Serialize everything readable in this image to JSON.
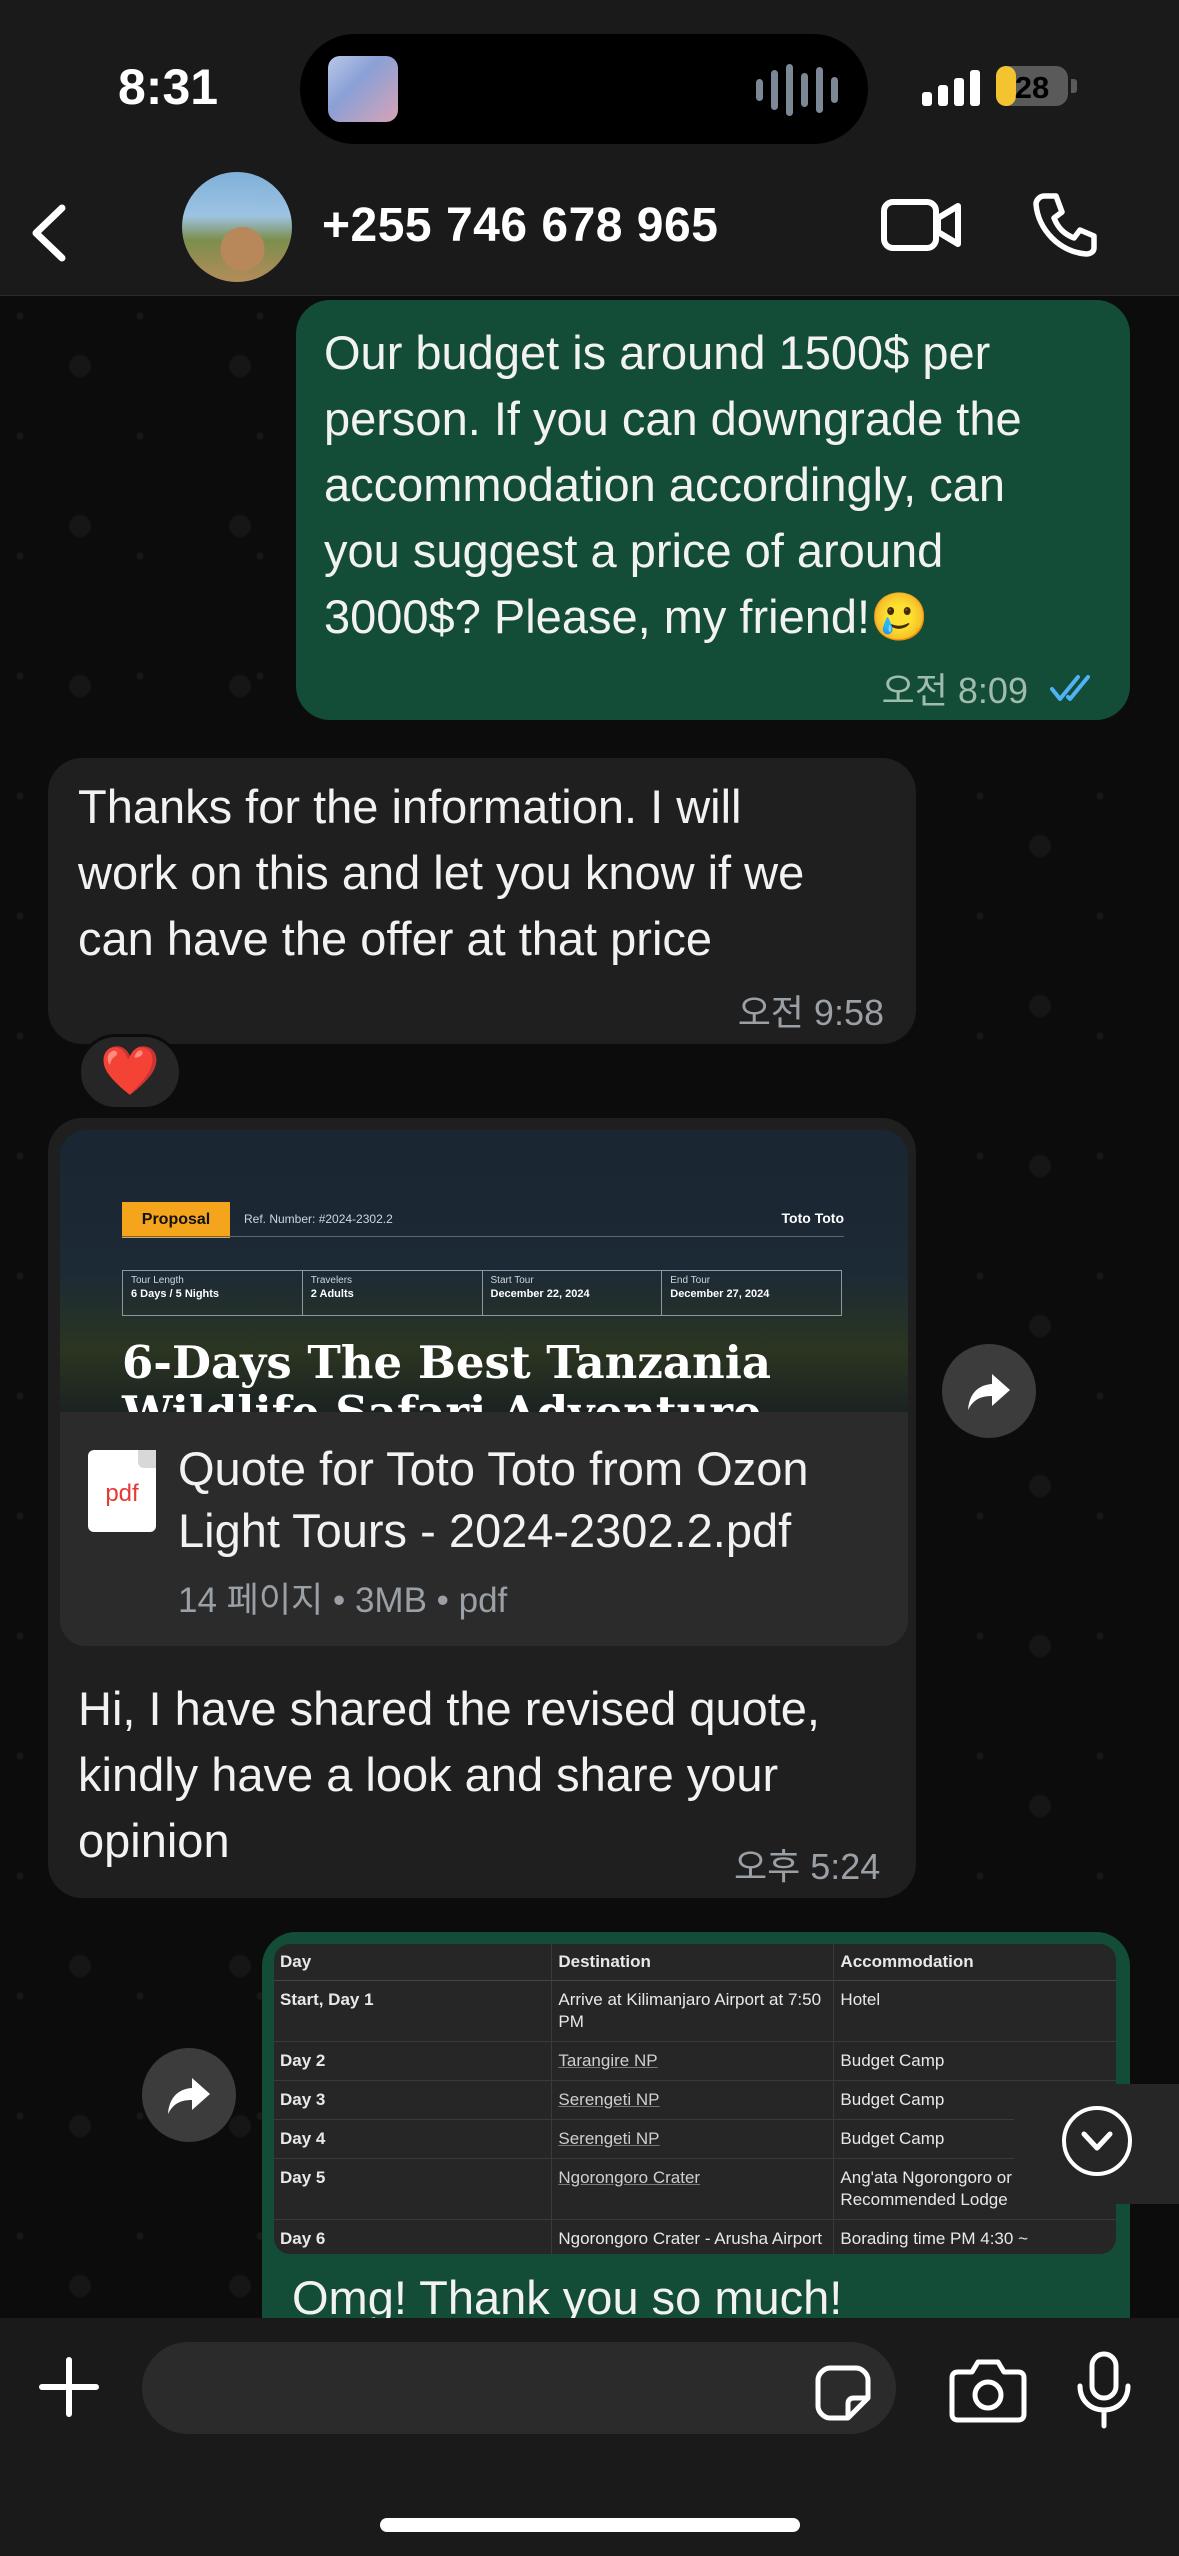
{
  "status_bar": {
    "time": "8:31",
    "battery": "28",
    "battery_fraction": 0.28
  },
  "header": {
    "contact_name": "+255 746 678 965"
  },
  "messages": [
    {
      "direction": "outgoing",
      "lines": [
        "Our budget is around 1500$ per",
        "person. If you can downgrade the",
        "accommodation accordingly, can",
        "you suggest a price of around",
        "3000$? Please, my friend!🥲"
      ],
      "time": "오전 8:09",
      "read": true
    },
    {
      "direction": "incoming",
      "lines": [
        "Thanks for the information. I will",
        "work on this and let you know if we",
        "can have the offer at that price"
      ],
      "time": "오전 9:58",
      "reaction": "❤️"
    },
    {
      "direction": "incoming",
      "type": "document",
      "preview": {
        "badge": "Proposal",
        "ref": "Ref. Number: #2024-2302.2",
        "brand": "Toto Toto",
        "fields": [
          {
            "label": "Tour Length",
            "value": "6 Days / 5 Nights"
          },
          {
            "label": "Travelers",
            "value": "2 Adults"
          },
          {
            "label": "Start Tour",
            "value": "December 22, 2024"
          },
          {
            "label": "End Tour",
            "value": "December 27, 2024"
          }
        ],
        "title_line1": "6-Days The Best Tanzania",
        "title_line2": "Wildlife Safari Adventure"
      },
      "file_name_line1": "Quote for Toto Toto from Ozon",
      "file_name_line2": "Light Tours - 2024-2302.2.pdf",
      "file_meta": "14 페이지 • 3MB • pdf",
      "file_type_label": "pdf",
      "caption_lines": [
        "Hi, I have shared the revised quote,",
        "kindly have a look and share your",
        "opinion"
      ],
      "time": "오후 5:24"
    },
    {
      "direction": "outgoing",
      "type": "table",
      "headers": [
        "Day",
        "Destination",
        "Accommodation"
      ],
      "rows": [
        [
          "Start, Day 1",
          "Arrive at Kilimanjaro Airport at 7:50 PM",
          "Hotel"
        ],
        [
          "Day 2",
          "Tarangire NP",
          "Budget Camp"
        ],
        [
          "Day 3",
          "Serengeti NP",
          "Budget Camp"
        ],
        [
          "Day 4",
          "Serengeti NP",
          "Budget Camp"
        ],
        [
          "Day 5",
          "Ngorongoro Crater",
          "Ang'ata Ngorongoro or Recommended Lodge"
        ],
        [
          "Day 6",
          "Ngorongoro Crater - Arusha Airport",
          "Borading time PM 4:30 ~"
        ]
      ],
      "text": "Omg! Thank you so much!"
    }
  ],
  "input": {
    "placeholder": ""
  },
  "icons": [
    "back-icon",
    "video-call-icon",
    "phone-icon",
    "forward-icon",
    "pdf-icon",
    "chevron-down-icon",
    "plus-icon",
    "sticker-icon",
    "camera-icon",
    "microphone-icon"
  ]
}
